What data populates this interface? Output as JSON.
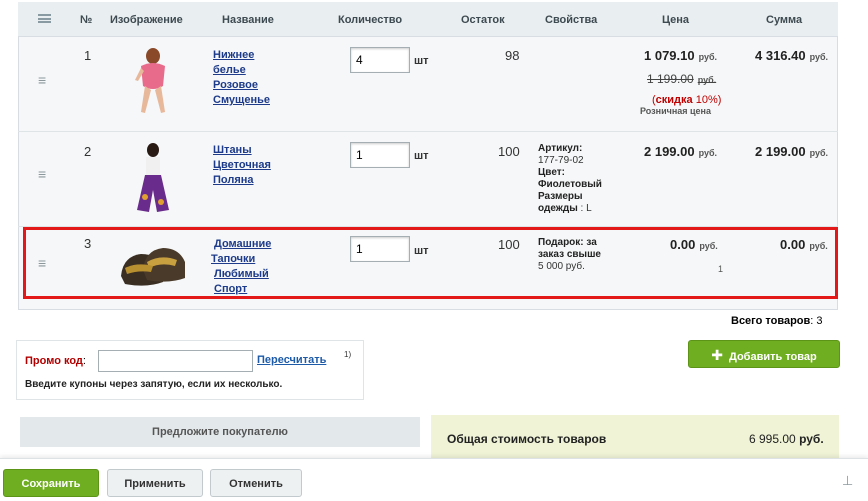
{
  "columns": [
    "№",
    "Изображение",
    "Название",
    "Количество",
    "Остаток",
    "Свойства",
    "Цена",
    "Сумма"
  ],
  "rows": [
    {
      "index": "1",
      "name_lines": [
        "Нижнее",
        "белье",
        "Розовое",
        "Смущенье"
      ],
      "quantity": "4",
      "unit": "шт",
      "stock": "98",
      "price": "1 079.10",
      "currency": "руб.",
      "old_price": "1 199.00",
      "discount_label": "скидка",
      "discount_value": "10%",
      "price_type": "Розничная цена",
      "sum": "4 316.40"
    },
    {
      "index": "2",
      "name_lines": [
        "Штаны",
        "Цветочная",
        "Поляна"
      ],
      "quantity": "1",
      "unit": "шт",
      "stock": "100",
      "props": [
        {
          "label": "Артикул:",
          "value": "177-79-02"
        },
        {
          "label": "Цвет:",
          "value": "Фиолетовый"
        },
        {
          "label": "Размеры одежды",
          "value": ": L"
        }
      ],
      "price": "2 199.00",
      "currency": "руб.",
      "sum": "2 199.00"
    },
    {
      "index": "3",
      "name_lines": [
        "Домашние",
        "Тапочки",
        "Любимый",
        "Спорт"
      ],
      "quantity": "1",
      "unit": "шт",
      "stock": "100",
      "gift_label": "Подарок: за заказ свыше",
      "gift_value": "5 000 руб.",
      "price": "0.00",
      "currency": "руб.",
      "price_note": "1",
      "sum": "0.00"
    }
  ],
  "total_items_label": "Всего товаров",
  "total_items_value": "3",
  "promo": {
    "label": "Промо код",
    "recalc_link": "Пересчитать",
    "footnote": "1)",
    "hint": "Введите купоны через запятую, если их несколько."
  },
  "add_product_button": "Добавить товар",
  "offer_to_buyer": "Предложите покупателю",
  "total_cost_label": "Общая стоимость товаров",
  "total_cost_value": "6 995.00",
  "currency": "руб.",
  "buttons": {
    "save": "Сохранить",
    "apply": "Применить",
    "cancel": "Отменить"
  },
  "colors": {
    "highlight": "#e31818",
    "accent": "#6fae20",
    "link": "#1d3b8a"
  }
}
